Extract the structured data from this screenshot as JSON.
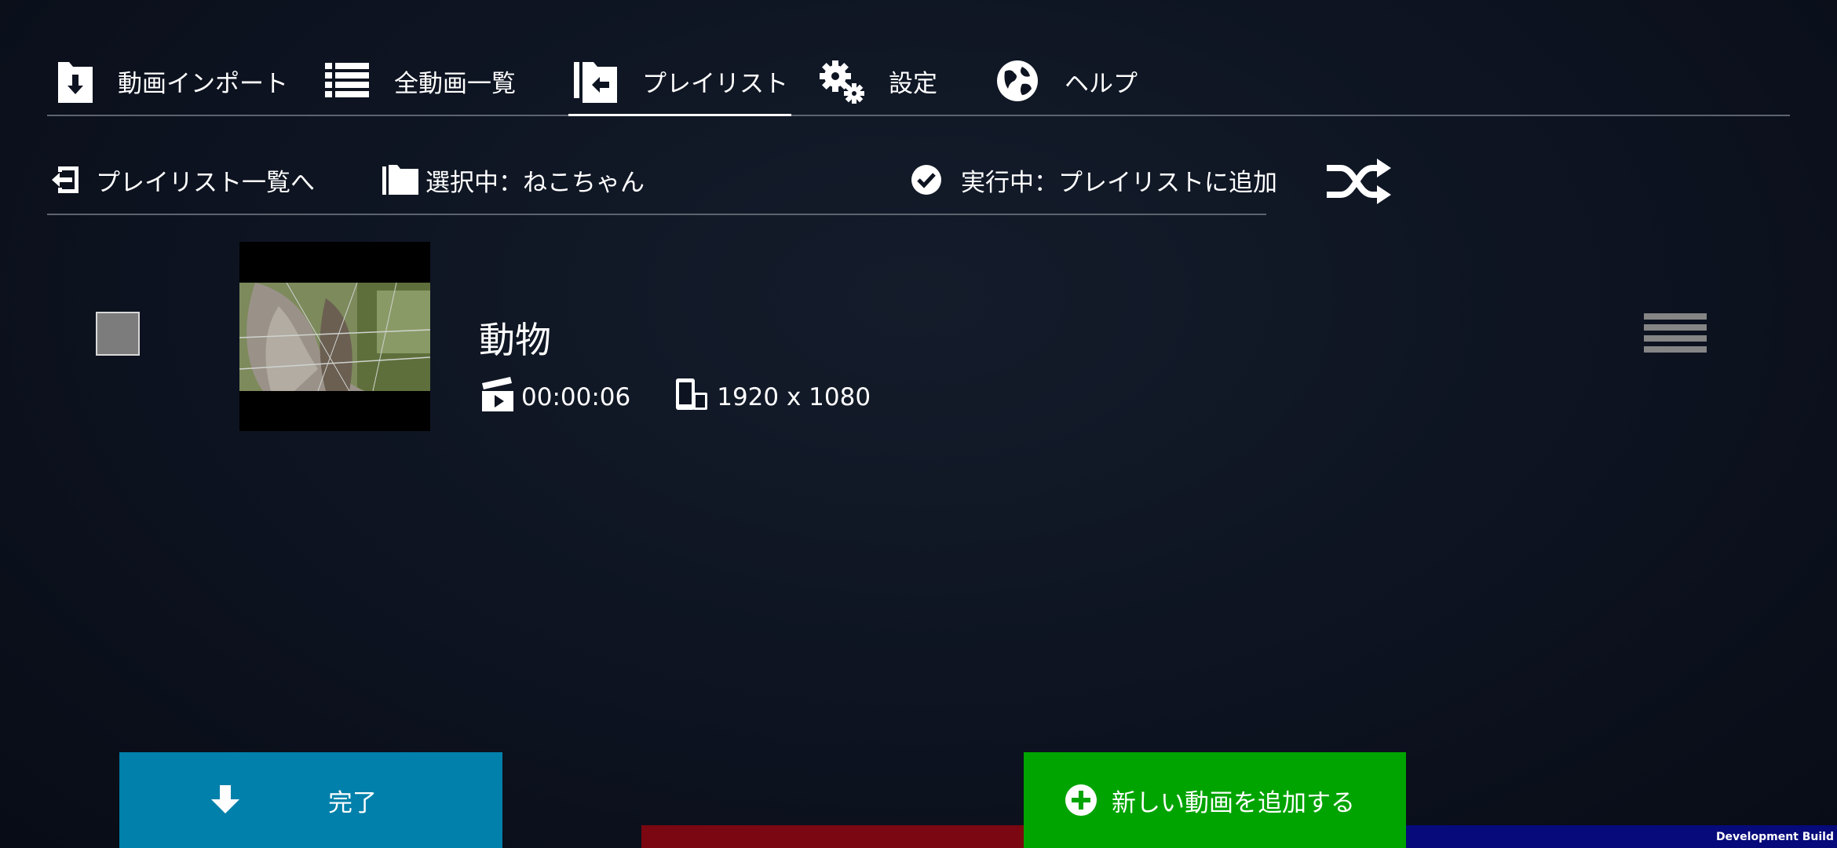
{
  "nav": {
    "tabs": [
      {
        "label": "動画インポート",
        "icon": "folder-download-icon"
      },
      {
        "label": "全動画一覧",
        "icon": "list-icon"
      },
      {
        "label": "プレイリスト",
        "icon": "folder-back-icon",
        "active": true
      },
      {
        "label": "設定",
        "icon": "gears-icon"
      },
      {
        "label": "ヘルプ",
        "icon": "globe-icon"
      }
    ]
  },
  "subbar": {
    "back_label": "プレイリスト一覧へ",
    "selected_label": "選択中：ねこちゃん",
    "running_label": "実行中：プレイリストに追加"
  },
  "playlist": {
    "items": [
      {
        "title": "動物",
        "duration": "00:00:06",
        "resolution": "1920 x 1080",
        "checked": false
      }
    ]
  },
  "buttons": {
    "done_label": "完了",
    "add_label": "新しい動画を追加する"
  },
  "footer": {
    "dev_build": "Development Build"
  },
  "colors": {
    "done_button": "#0080aa",
    "add_button": "#00a400",
    "bottom_red": "#7a0711",
    "bottom_blue": "#070a7a",
    "background": "#0d1320"
  }
}
